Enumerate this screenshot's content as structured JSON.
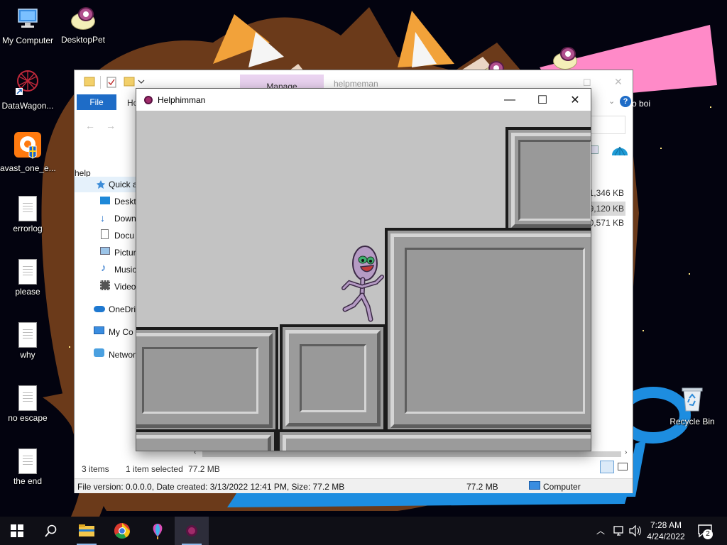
{
  "desktop": {
    "icons": [
      {
        "label": "My Computer"
      },
      {
        "label": "DesktopPet"
      },
      {
        "label": "DataWagon..."
      },
      {
        "label": "avast_one_e..."
      },
      {
        "label": "errorlog"
      },
      {
        "label": "please"
      },
      {
        "label": "why"
      },
      {
        "label": "no escape"
      },
      {
        "label": "the end"
      },
      {
        "label": "Recycle Bin"
      }
    ]
  },
  "explorer": {
    "title": "helpmeman",
    "manage_tab": "Manage",
    "file_tab": "File",
    "home_tab": "Ho",
    "desktop_item_partial": "Desk",
    "help_item_partial": "help",
    "right_label_partial": "o boi",
    "sidebar": [
      {
        "label": "Quick a"
      },
      {
        "label": "Deskt"
      },
      {
        "label": "Down"
      },
      {
        "label": "Docu"
      },
      {
        "label": "Pictur"
      },
      {
        "label": "Music"
      },
      {
        "label": "Video"
      },
      {
        "label": "OneDriv"
      },
      {
        "label": "My Co"
      },
      {
        "label": "Networ"
      }
    ],
    "sizes": [
      "1,346 KB",
      "9,120 KB",
      "0,571 KB"
    ],
    "status": {
      "items": "3 items",
      "selected": "1 item selected",
      "selected_size": "77.2 MB"
    },
    "details_bar": {
      "info": "File version: 0.0.0.0, Date created: 3/13/2022 12:41 PM, Size: 77.2 MB",
      "size": "77.2 MB",
      "location": "Computer"
    }
  },
  "game_window": {
    "title": "Helphimman",
    "minimize": "—",
    "maximize": "☐",
    "close": "✕"
  },
  "taskbar": {
    "time": "7:28 AM",
    "date": "4/24/2022",
    "notification_count": "2"
  },
  "colors": {
    "accent_blue": "#1e6cc7",
    "manage_tab": "#ead3f0",
    "game_bg": "#c3c3c3",
    "character": "#b59bc4"
  }
}
